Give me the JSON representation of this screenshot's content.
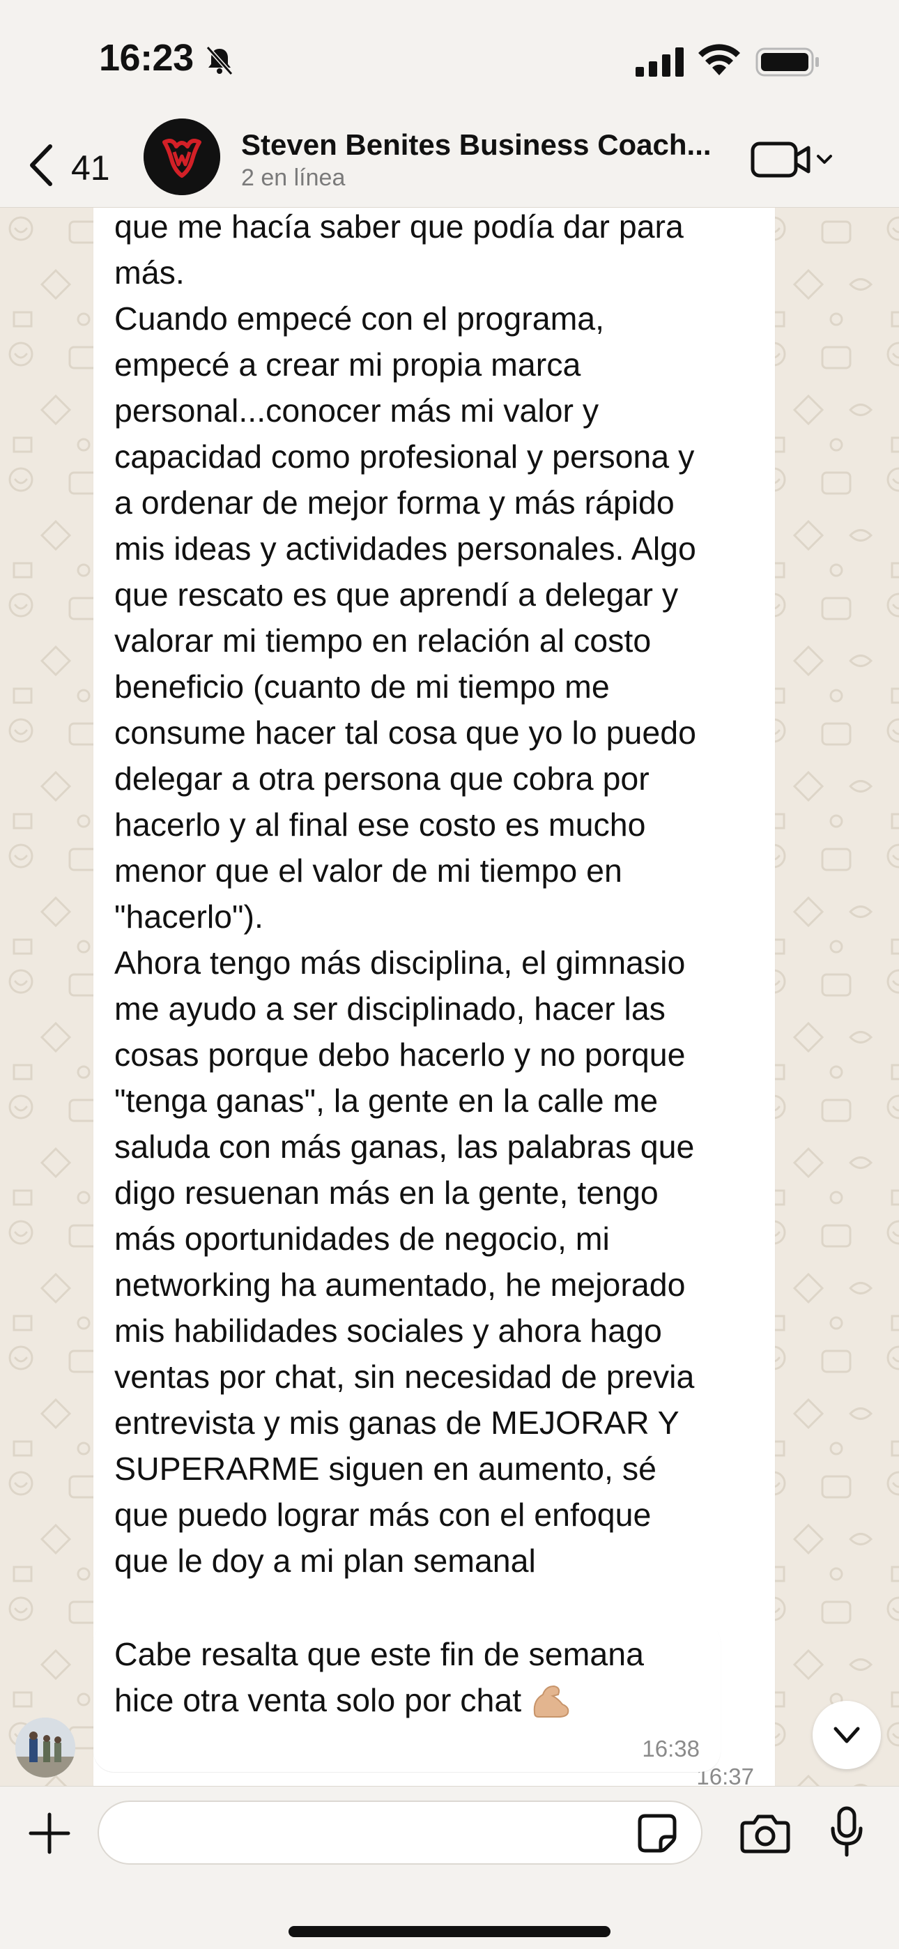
{
  "status_bar": {
    "time": "16:23",
    "icons": [
      "bell-slash-icon",
      "cellular-signal-icon",
      "wifi-icon",
      "battery-icon"
    ]
  },
  "header": {
    "back_count": "41",
    "title": "Steven Benites Business Coach...",
    "subtitle": "2 en línea",
    "icons": [
      "chevron-left-icon",
      "group-logo",
      "video-call-icon",
      "chevron-down-icon"
    ]
  },
  "messages": [
    {
      "text": "embargo tenía siempre algo dentro mío\nque me hacía saber que podía dar para\nmás.\nCuando empecé con el programa,\nempecé a crear mi propia marca\npersonal...conocer más mi valor y\ncapacidad como profesional y persona y\na ordenar de mejor forma y más rápido\nmis ideas y actividades personales. Algo\nque rescato es que aprendí a delegar y\nvalorar mi tiempo en relación al costo\nbeneficio (cuanto de mi tiempo me\nconsume hacer tal cosa que yo lo puedo\ndelegar a otra persona que cobra por\nhacerlo y al final ese costo es mucho\nmenor que el valor de mi tiempo en\n\"hacerlo\").\nAhora tengo más disciplina, el gimnasio\nme ayudo a ser disciplinado, hacer las\ncosas porque debo hacerlo y no porque\n\"tenga ganas\", la gente en la calle me\nsaluda con más ganas, las palabras que\ndigo resuenan más en la gente, tengo\nmás oportunidades de negocio, mi\nnetworking ha aumentado, he mejorado\nmis habilidades sociales y ahora hago\nventas por chat, sin necesidad de previa\nentrevista y mis ganas de MEJORAR Y\nSUPERARME siguen en aumento, sé\nque puedo lograr más con el enfoque\nque le doy a mi plan semanal",
      "time": "16:37"
    },
    {
      "text": "Cabe resalta que este fin de semana\nhice otra venta solo por chat ",
      "emoji": "flexed-biceps-icon",
      "time": "16:38"
    }
  ],
  "input_bar": {
    "message_value": "",
    "icons": [
      "plus-icon",
      "sticker-icon",
      "camera-icon",
      "microphone-icon"
    ]
  },
  "colors": {
    "background": "#efe9e0",
    "bubble": "#ffffff",
    "timestamp": "#8a8a8a",
    "logo_red": "#d32027"
  }
}
